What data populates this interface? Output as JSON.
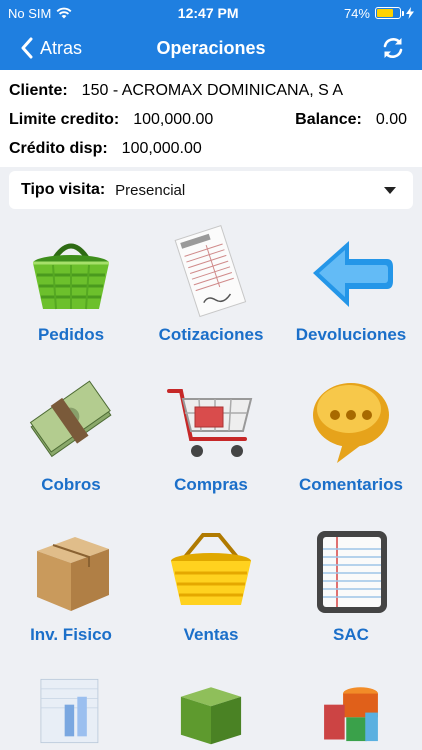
{
  "status_bar": {
    "carrier": "No SIM",
    "time": "12:47 PM",
    "battery": "74%",
    "battery_level": 0.74
  },
  "nav": {
    "back_label": "Atras",
    "title": "Operaciones"
  },
  "client": {
    "cliente_label": "Cliente:",
    "cliente_value": "150 - ACROMAX DOMINICANA, S A",
    "limite_label": "Limite credito:",
    "limite_value": "100,000.00",
    "balance_label": "Balance:",
    "balance_value": "0.00",
    "credito_label": "Crédito disp:",
    "credito_value": "100,000.00"
  },
  "visit": {
    "label": "Tipo visita:",
    "value": "Presencial"
  },
  "operations": [
    {
      "label": "Pedidos",
      "icon": "basket-icon"
    },
    {
      "label": "Cotizaciones",
      "icon": "invoice-icon"
    },
    {
      "label": "Devoluciones",
      "icon": "return-arrow-icon"
    },
    {
      "label": "Cobros",
      "icon": "money-icon"
    },
    {
      "label": "Compras",
      "icon": "shopping-cart-icon"
    },
    {
      "label": "Comentarios",
      "icon": "speech-bubble-icon"
    },
    {
      "label": "Inv. Fisico",
      "icon": "box-icon"
    },
    {
      "label": "Ventas",
      "icon": "yellow-basket-icon"
    },
    {
      "label": "SAC",
      "icon": "notebook-icon"
    }
  ],
  "colors": {
    "primary": "#1f7fe0",
    "label": "#1b6fc9",
    "background": "#eef0f4"
  }
}
